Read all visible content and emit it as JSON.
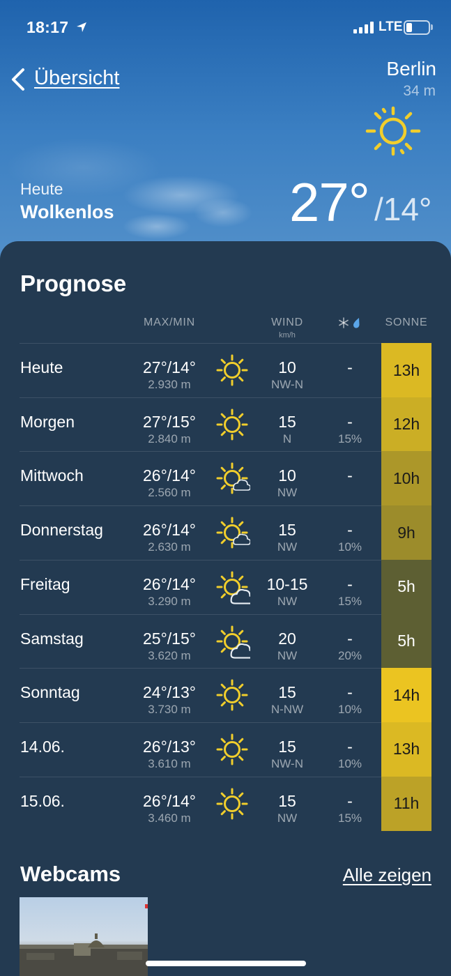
{
  "status_bar": {
    "time": "18:17",
    "network": "LTE",
    "battery_level": 0.25
  },
  "header": {
    "back_label": "Übersicht",
    "city": "Berlin",
    "elevation": "34 m",
    "today_label": "Heute",
    "condition": "Wolkenlos",
    "temp_max": "27°",
    "temp_min": "/14°",
    "weather_icon": "sun-icon"
  },
  "forecast": {
    "title": "Prognose",
    "columns": {
      "maxmin": "MAX/MIN",
      "wind": "WIND",
      "wind_unit": "km/h",
      "precip_icons": "snowflake-icon + raindrop-icon",
      "sun": "SONNE"
    },
    "rows": [
      {
        "day": "Heute",
        "temp": "27°/14°",
        "altitude": "2.930 m",
        "icon": "sun-icon",
        "wind": "10",
        "dir": "NW-N",
        "precip": "-",
        "prob": "",
        "sun": "13h",
        "sun_hours": 13
      },
      {
        "day": "Morgen",
        "temp": "27°/15°",
        "altitude": "2.840 m",
        "icon": "sun-icon",
        "wind": "15",
        "dir": "N",
        "precip": "-",
        "prob": "15%",
        "sun": "12h",
        "sun_hours": 12
      },
      {
        "day": "Mittwoch",
        "temp": "26°/14°",
        "altitude": "2.560 m",
        "icon": "sun-small-cloud-icon",
        "wind": "10",
        "dir": "NW",
        "precip": "-",
        "prob": "",
        "sun": "10h",
        "sun_hours": 10
      },
      {
        "day": "Donnerstag",
        "temp": "26°/14°",
        "altitude": "2.630 m",
        "icon": "sun-small-cloud-icon",
        "wind": "15",
        "dir": "NW",
        "precip": "-",
        "prob": "10%",
        "sun": "9h",
        "sun_hours": 9
      },
      {
        "day": "Freitag",
        "temp": "26°/14°",
        "altitude": "3.290 m",
        "icon": "sun-cloud-icon",
        "wind": "10-15",
        "dir": "NW",
        "precip": "-",
        "prob": "15%",
        "sun": "5h",
        "sun_hours": 5
      },
      {
        "day": "Samstag",
        "temp": "25°/15°",
        "altitude": "3.620 m",
        "icon": "sun-cloud-icon",
        "wind": "20",
        "dir": "NW",
        "precip": "-",
        "prob": "20%",
        "sun": "5h",
        "sun_hours": 5
      },
      {
        "day": "Sonntag",
        "temp": "24°/13°",
        "altitude": "3.730 m",
        "icon": "sun-icon",
        "wind": "15",
        "dir": "N-NW",
        "precip": "-",
        "prob": "10%",
        "sun": "14h",
        "sun_hours": 14
      },
      {
        "day": "14.06.",
        "temp": "26°/13°",
        "altitude": "3.610 m",
        "icon": "sun-icon",
        "wind": "15",
        "dir": "NW-N",
        "precip": "-",
        "prob": "10%",
        "sun": "13h",
        "sun_hours": 13
      },
      {
        "day": "15.06.",
        "temp": "26°/14°",
        "altitude": "3.460 m",
        "icon": "sun-icon",
        "wind": "15",
        "dir": "NW",
        "precip": "-",
        "prob": "15%",
        "sun": "11h",
        "sun_hours": 11
      }
    ]
  },
  "webcams": {
    "title": "Webcams",
    "show_all": "Alle zeigen"
  },
  "colors": {
    "sun_yellow": "#f1ce2c",
    "panel_bg": "#233a51",
    "sky_top": "#1f63ad",
    "sun_cell_high": "#ebc421",
    "sun_cell_low": "#5d5f33"
  }
}
